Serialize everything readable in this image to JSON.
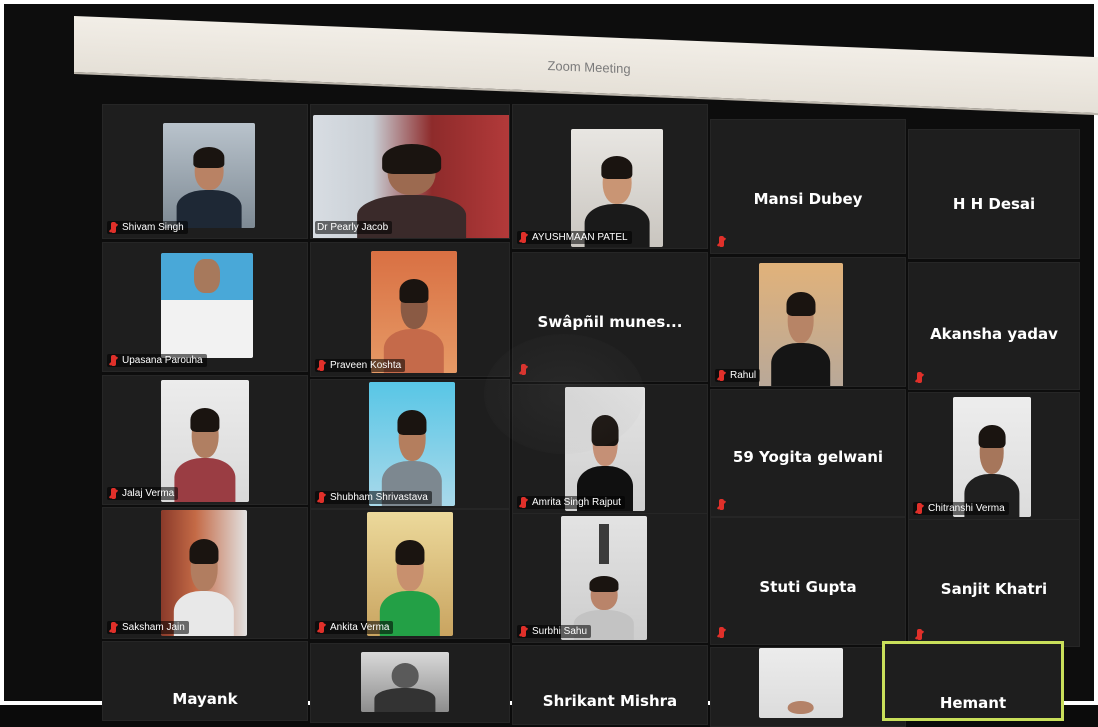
{
  "window": {
    "title": "Zoom Meeting"
  },
  "participants": [
    {
      "name": "Shivam Singh",
      "muted": true,
      "video": true
    },
    {
      "name": "Dr Pearly Jacob",
      "muted": false,
      "video": true
    },
    {
      "name": "AYUSHMAAN PATEL",
      "muted": true,
      "video": true
    },
    {
      "name": "Mansi Dubey",
      "muted": true,
      "video": false
    },
    {
      "name": "H H Desai",
      "muted": false,
      "video": false
    },
    {
      "name": "Upasana Parouha",
      "muted": true,
      "video": true
    },
    {
      "name": "Praveen Koshta",
      "muted": true,
      "video": true
    },
    {
      "name": "Swâpñil munes...",
      "muted": true,
      "video": false
    },
    {
      "name": "Rahul",
      "muted": true,
      "video": true
    },
    {
      "name": "Akansha yadav",
      "muted": true,
      "video": false
    },
    {
      "name": "Jalaj Verma",
      "muted": true,
      "video": true
    },
    {
      "name": "Shubham Shrivastava",
      "muted": true,
      "video": true
    },
    {
      "name": "Amrita Singh Rajput",
      "muted": true,
      "video": true
    },
    {
      "name": "59 Yogita gelwani",
      "muted": true,
      "video": false
    },
    {
      "name": "Chitranshi Verma",
      "muted": true,
      "video": true
    },
    {
      "name": "Saksham Jain",
      "muted": true,
      "video": true
    },
    {
      "name": "Ankita Verma",
      "muted": true,
      "video": true
    },
    {
      "name": "Surbhi Sahu",
      "muted": true,
      "video": true
    },
    {
      "name": "Stuti Gupta",
      "muted": true,
      "video": false
    },
    {
      "name": "Sanjit Khatri",
      "muted": true,
      "video": false
    },
    {
      "name": "Mayank",
      "muted": false,
      "video": false
    },
    {
      "name": "",
      "muted": false,
      "video": true
    },
    {
      "name": "Shrikant Mishra",
      "muted": false,
      "video": false
    },
    {
      "name": "",
      "muted": false,
      "video": true
    },
    {
      "name": "Hemant",
      "muted": false,
      "video": false,
      "active": true
    }
  ]
}
